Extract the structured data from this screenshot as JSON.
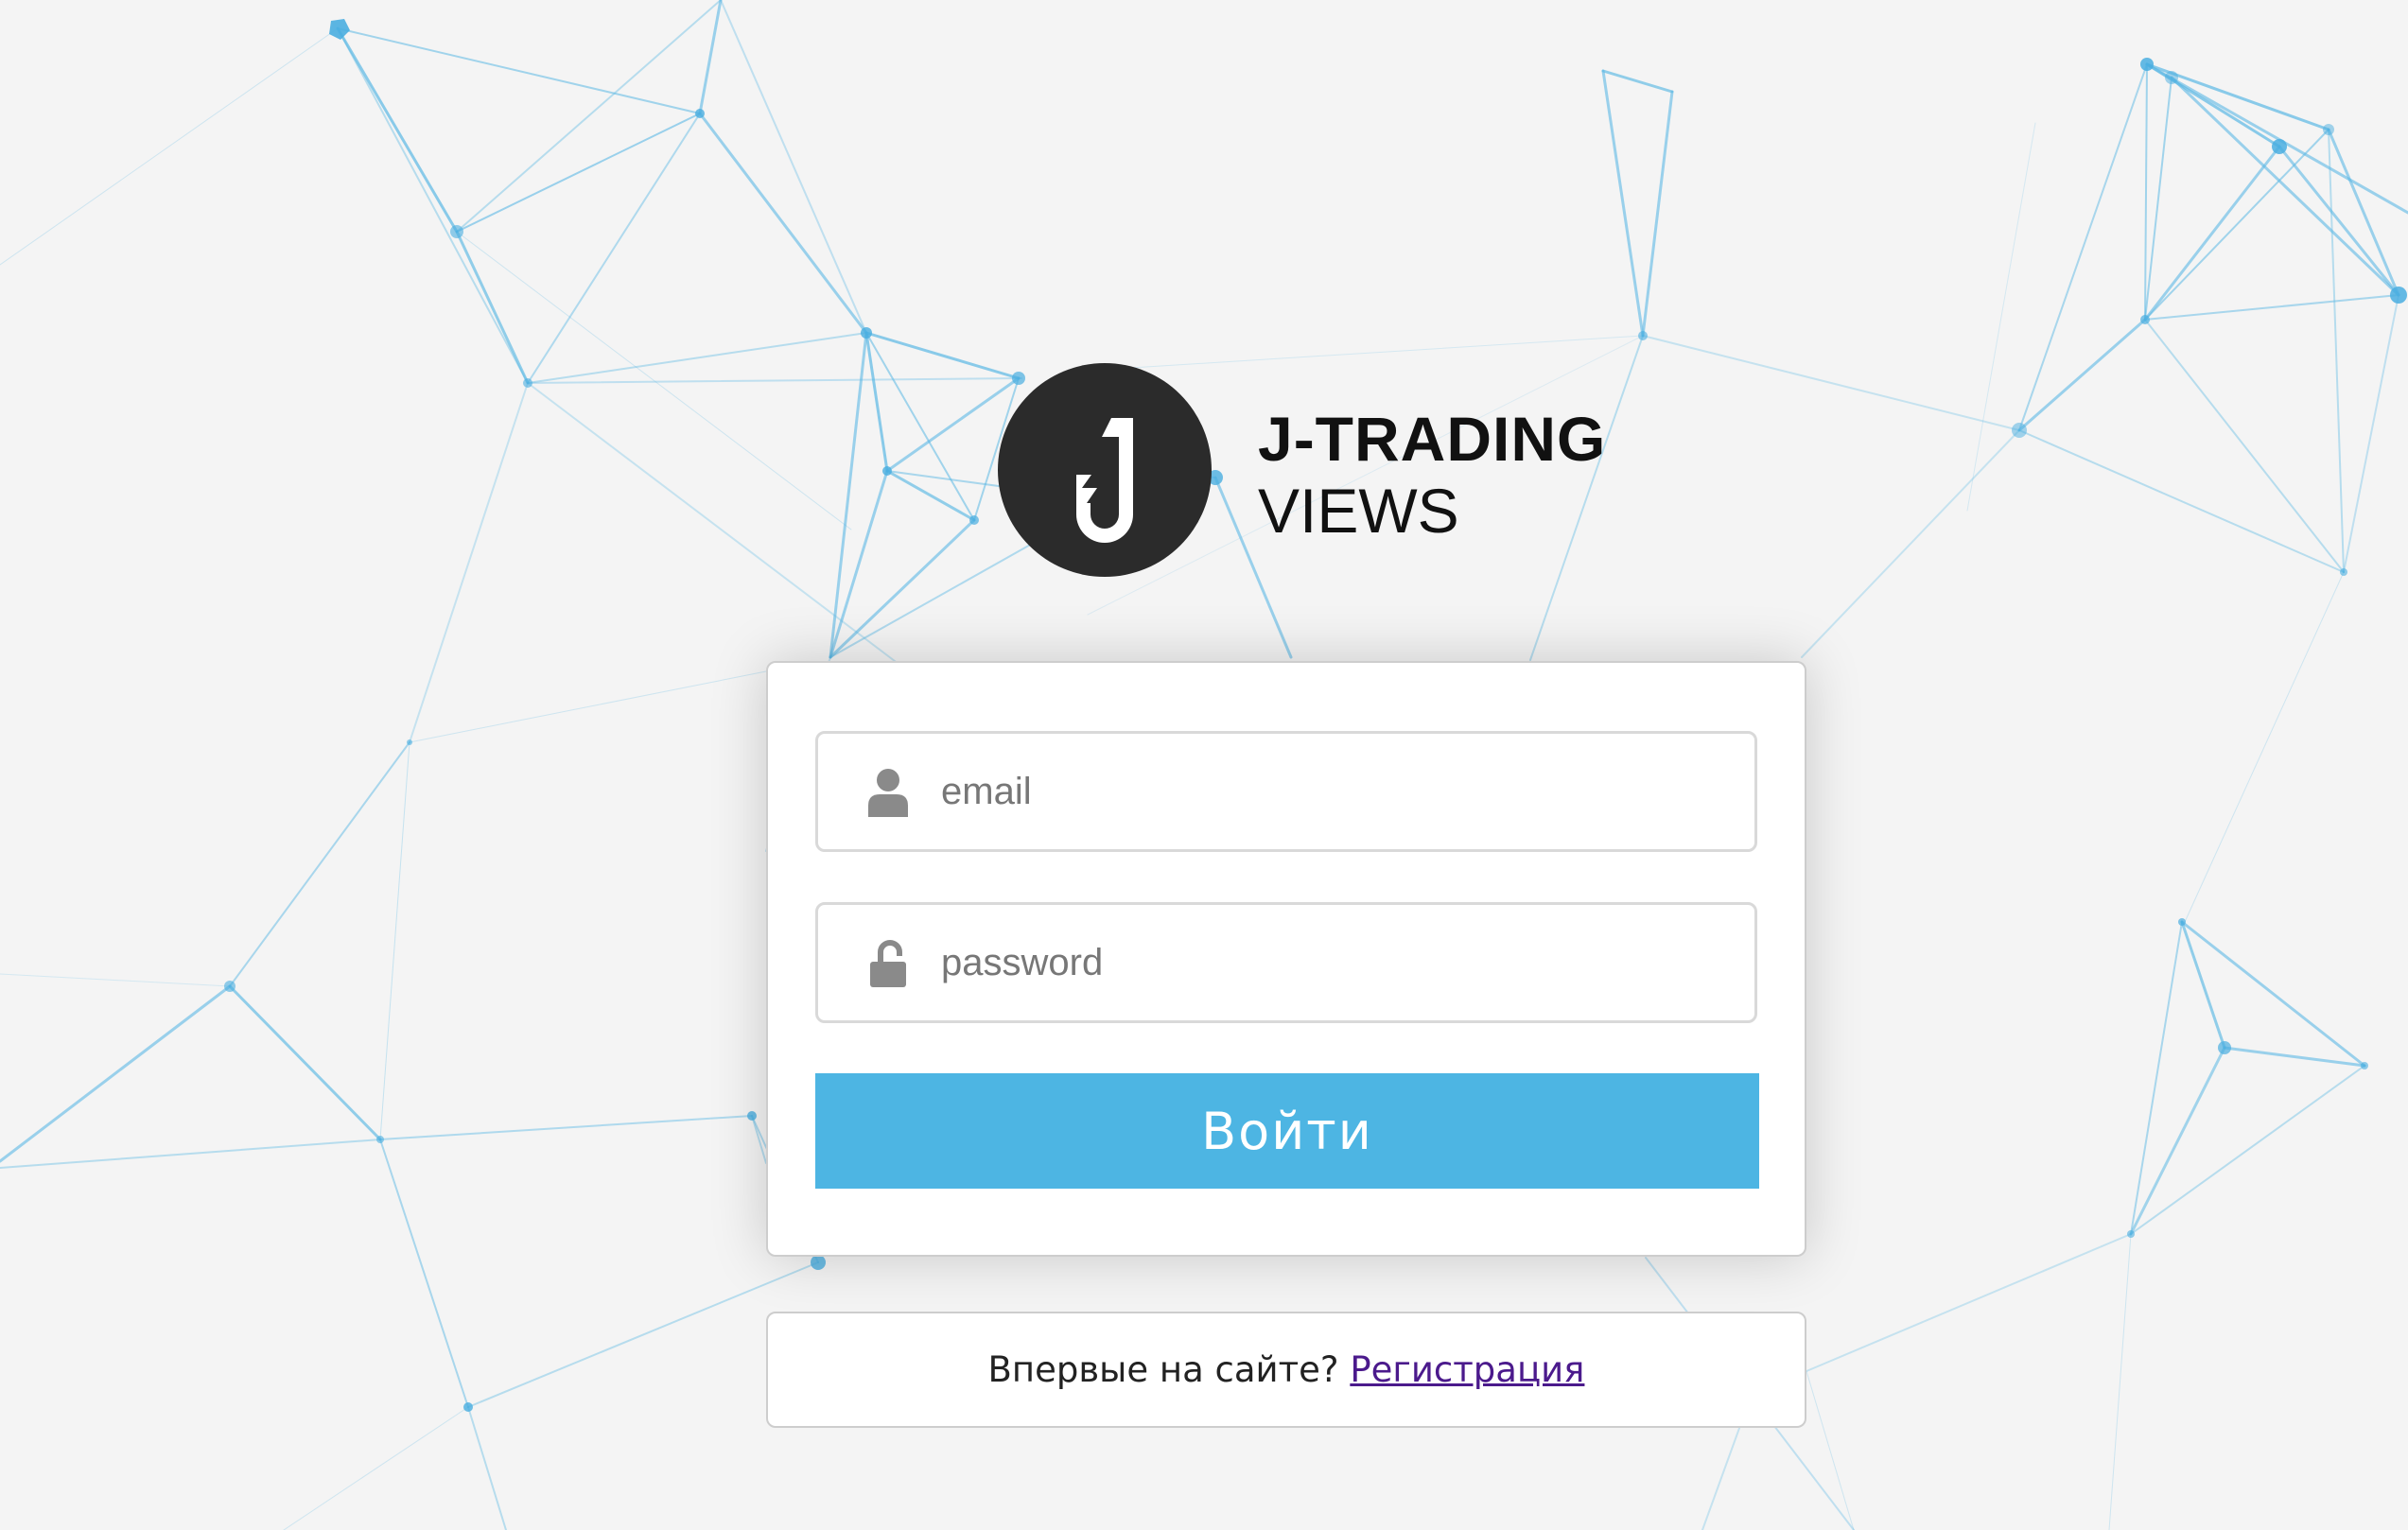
{
  "brand": {
    "name_line1": "J-TRADING",
    "name_line2": "VIEWS",
    "logo_icon": "j-lightning-logo-icon",
    "logo_color": "#2b2b2b"
  },
  "login_form": {
    "email": {
      "placeholder": "email",
      "value": "",
      "icon": "user-icon"
    },
    "password": {
      "placeholder": "password",
      "value": "",
      "icon": "unlock-icon"
    },
    "submit_label": "Войти",
    "submit_color": "#4db5e3"
  },
  "register": {
    "prompt": "Впервые на сайте?",
    "link_label": "Регистрация",
    "link_color": "#4b1a8c"
  },
  "theme": {
    "background": "#f4f4f4",
    "network_color": "#5bb8e4"
  }
}
